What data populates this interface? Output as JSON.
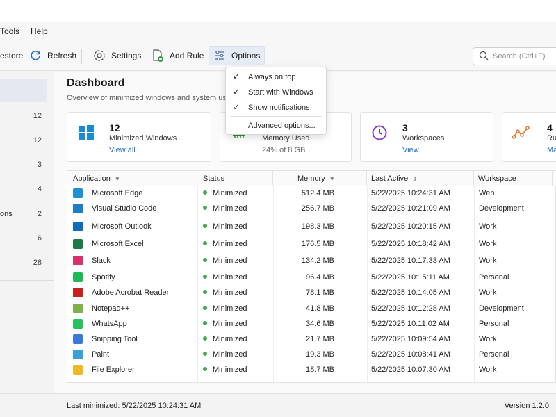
{
  "menubar": {
    "tools": "Tools",
    "help": "Help"
  },
  "toolbar": {
    "restore": "estore",
    "refresh": "Refresh",
    "settings": "Settings",
    "add_rule": "Add Rule",
    "options": "Options"
  },
  "search": {
    "placeholder": "Search (Ctrl+F)"
  },
  "options_menu": {
    "items": [
      {
        "label": "Always on top",
        "checked": true
      },
      {
        "label": "Start with Windows",
        "checked": true
      },
      {
        "label": "Show notifications",
        "checked": true
      },
      {
        "label": "Advanced options...",
        "checked": false
      }
    ]
  },
  "sidebar": {
    "items": [
      {
        "label": "",
        "count": "12"
      },
      {
        "label": "",
        "count": "12"
      },
      {
        "label": "",
        "count": "3"
      },
      {
        "label": "",
        "count": "4"
      },
      {
        "label": "ons",
        "count": "2"
      },
      {
        "label": "",
        "count": "6"
      },
      {
        "label": "",
        "count": "28"
      }
    ]
  },
  "dashboard": {
    "title": "Dashboard",
    "subtitle": "Overview of minimized windows and system usag"
  },
  "cards": [
    {
      "value": "12",
      "label": "Minimized Windows",
      "link": "View all"
    },
    {
      "value": "",
      "label": "Memory Used",
      "sub": "24% of 8 GB"
    },
    {
      "value": "3",
      "label": "Workspaces",
      "link": "View"
    },
    {
      "value": "4",
      "label": "Rul",
      "link": "Ma"
    }
  ],
  "table": {
    "headers": {
      "application": "Application",
      "status": "Status",
      "memory": "Memory",
      "last_active": "Last Active",
      "workspace": "Workspace"
    },
    "rows": [
      {
        "app": "Microsoft Edge",
        "status": "Minimized",
        "memory": "512.4 MB",
        "last": "5/22/2025 10:24:31 AM",
        "ws": "Web",
        "icon": "edge-icon",
        "color": "#1f8fd6"
      },
      {
        "app": "Visual Studio Code",
        "status": "Minimized",
        "memory": "256.7 MB",
        "last": "5/22/2025 10:21:09 AM",
        "ws": "Development",
        "icon": "vscode-icon",
        "color": "#1e7ccd"
      },
      {
        "app": "Microsoft Outlook",
        "status": "Minimized",
        "memory": "198.3 MB",
        "last": "5/22/2025 10:20:15 AM",
        "ws": "Work",
        "icon": "outlook-icon",
        "color": "#0f6cbd"
      },
      {
        "app": "Microsoft Excel",
        "status": "Minimized",
        "memory": "176.5 MB",
        "last": "5/22/2025 10:18:42 AM",
        "ws": "Work",
        "icon": "excel-icon",
        "color": "#1d7a45"
      },
      {
        "app": "Slack",
        "status": "Minimized",
        "memory": "134.2 MB",
        "last": "5/22/2025 10:17:33 AM",
        "ws": "Work",
        "icon": "slack-icon",
        "color": "#d6336c"
      },
      {
        "app": "Spotify",
        "status": "Minimized",
        "memory": "96.4 MB",
        "last": "5/22/2025 10:15:11 AM",
        "ws": "Personal",
        "icon": "spotify-icon",
        "color": "#1db954"
      },
      {
        "app": "Adobe Acrobat Reader",
        "status": "Minimized",
        "memory": "78.1 MB",
        "last": "5/22/2025 10:14:05 AM",
        "ws": "Work",
        "icon": "acrobat-icon",
        "color": "#c8211b"
      },
      {
        "app": "Notepad++",
        "status": "Minimized",
        "memory": "41.8 MB",
        "last": "5/22/2025 10:12:28 AM",
        "ws": "Development",
        "icon": "notepadpp-icon",
        "color": "#7fb04a"
      },
      {
        "app": "WhatsApp",
        "status": "Minimized",
        "memory": "34.6 MB",
        "last": "5/22/2025 10:11:02 AM",
        "ws": "Personal",
        "icon": "whatsapp-icon",
        "color": "#25c25f"
      },
      {
        "app": "Snipping Tool",
        "status": "Minimized",
        "memory": "21.7 MB",
        "last": "5/22/2025 10:09:54 AM",
        "ws": "Work",
        "icon": "snipping-tool-icon",
        "color": "#3a79d8"
      },
      {
        "app": "Paint",
        "status": "Minimized",
        "memory": "19.3 MB",
        "last": "5/22/2025 10:08:41 AM",
        "ws": "Personal",
        "icon": "paint-icon",
        "color": "#3aa0d8"
      },
      {
        "app": "File Explorer",
        "status": "Minimized",
        "memory": "18.7 MB",
        "last": "5/22/2025 10:07:30 AM",
        "ws": "Work",
        "icon": "file-explorer-icon",
        "color": "#f2b629"
      }
    ]
  },
  "statusbar": {
    "last_minimized": "Last minimized:  5/22/2025 10:24:31 AM",
    "version": "Version 1.2.0"
  },
  "colors": {
    "accent": "#1a6fc7",
    "status_green": "#3fae4a",
    "windows_blue": "#1a8ad4",
    "memory_green": "#2e8b3a",
    "workspace_purple": "#8a3fc7",
    "rules_orange": "#e8782a"
  }
}
